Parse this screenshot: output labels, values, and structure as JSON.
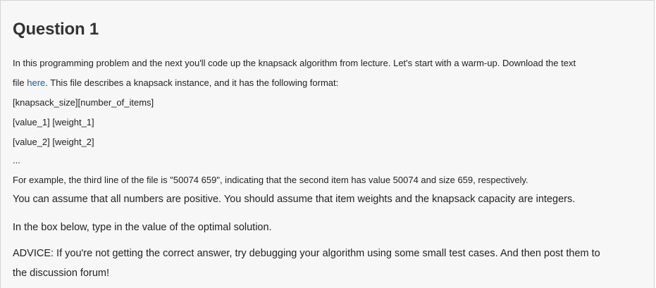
{
  "question": {
    "title": "Question 1",
    "intro_line1": "In this programming problem and the next you'll code up the knapsack algorithm from lecture. Let's start with a warm-up. Download the text",
    "intro_line2_prefix": "file ",
    "download_link": "here",
    "intro_line2_suffix": ". This file describes a knapsack instance, and it has the following format:",
    "format_lines": [
      "[knapsack_size][number_of_items]",
      "[value_1] [weight_1]",
      "[value_2] [weight_2]",
      "..."
    ],
    "example": "For example, the third line of the file is \"50074 659\", indicating that the second item has value 50074 and size 659, respectively.",
    "assumption": "You can assume that all numbers are positive. You should assume that item weights and the knapsack capacity are integers.",
    "instruction": "In the box below, type in the value of the optimal solution.",
    "advice_line1": "ADVICE: If you're not getting the correct answer, try debugging your algorithm using some small test cases. And then post them to",
    "advice_line2": "the discussion forum!"
  }
}
